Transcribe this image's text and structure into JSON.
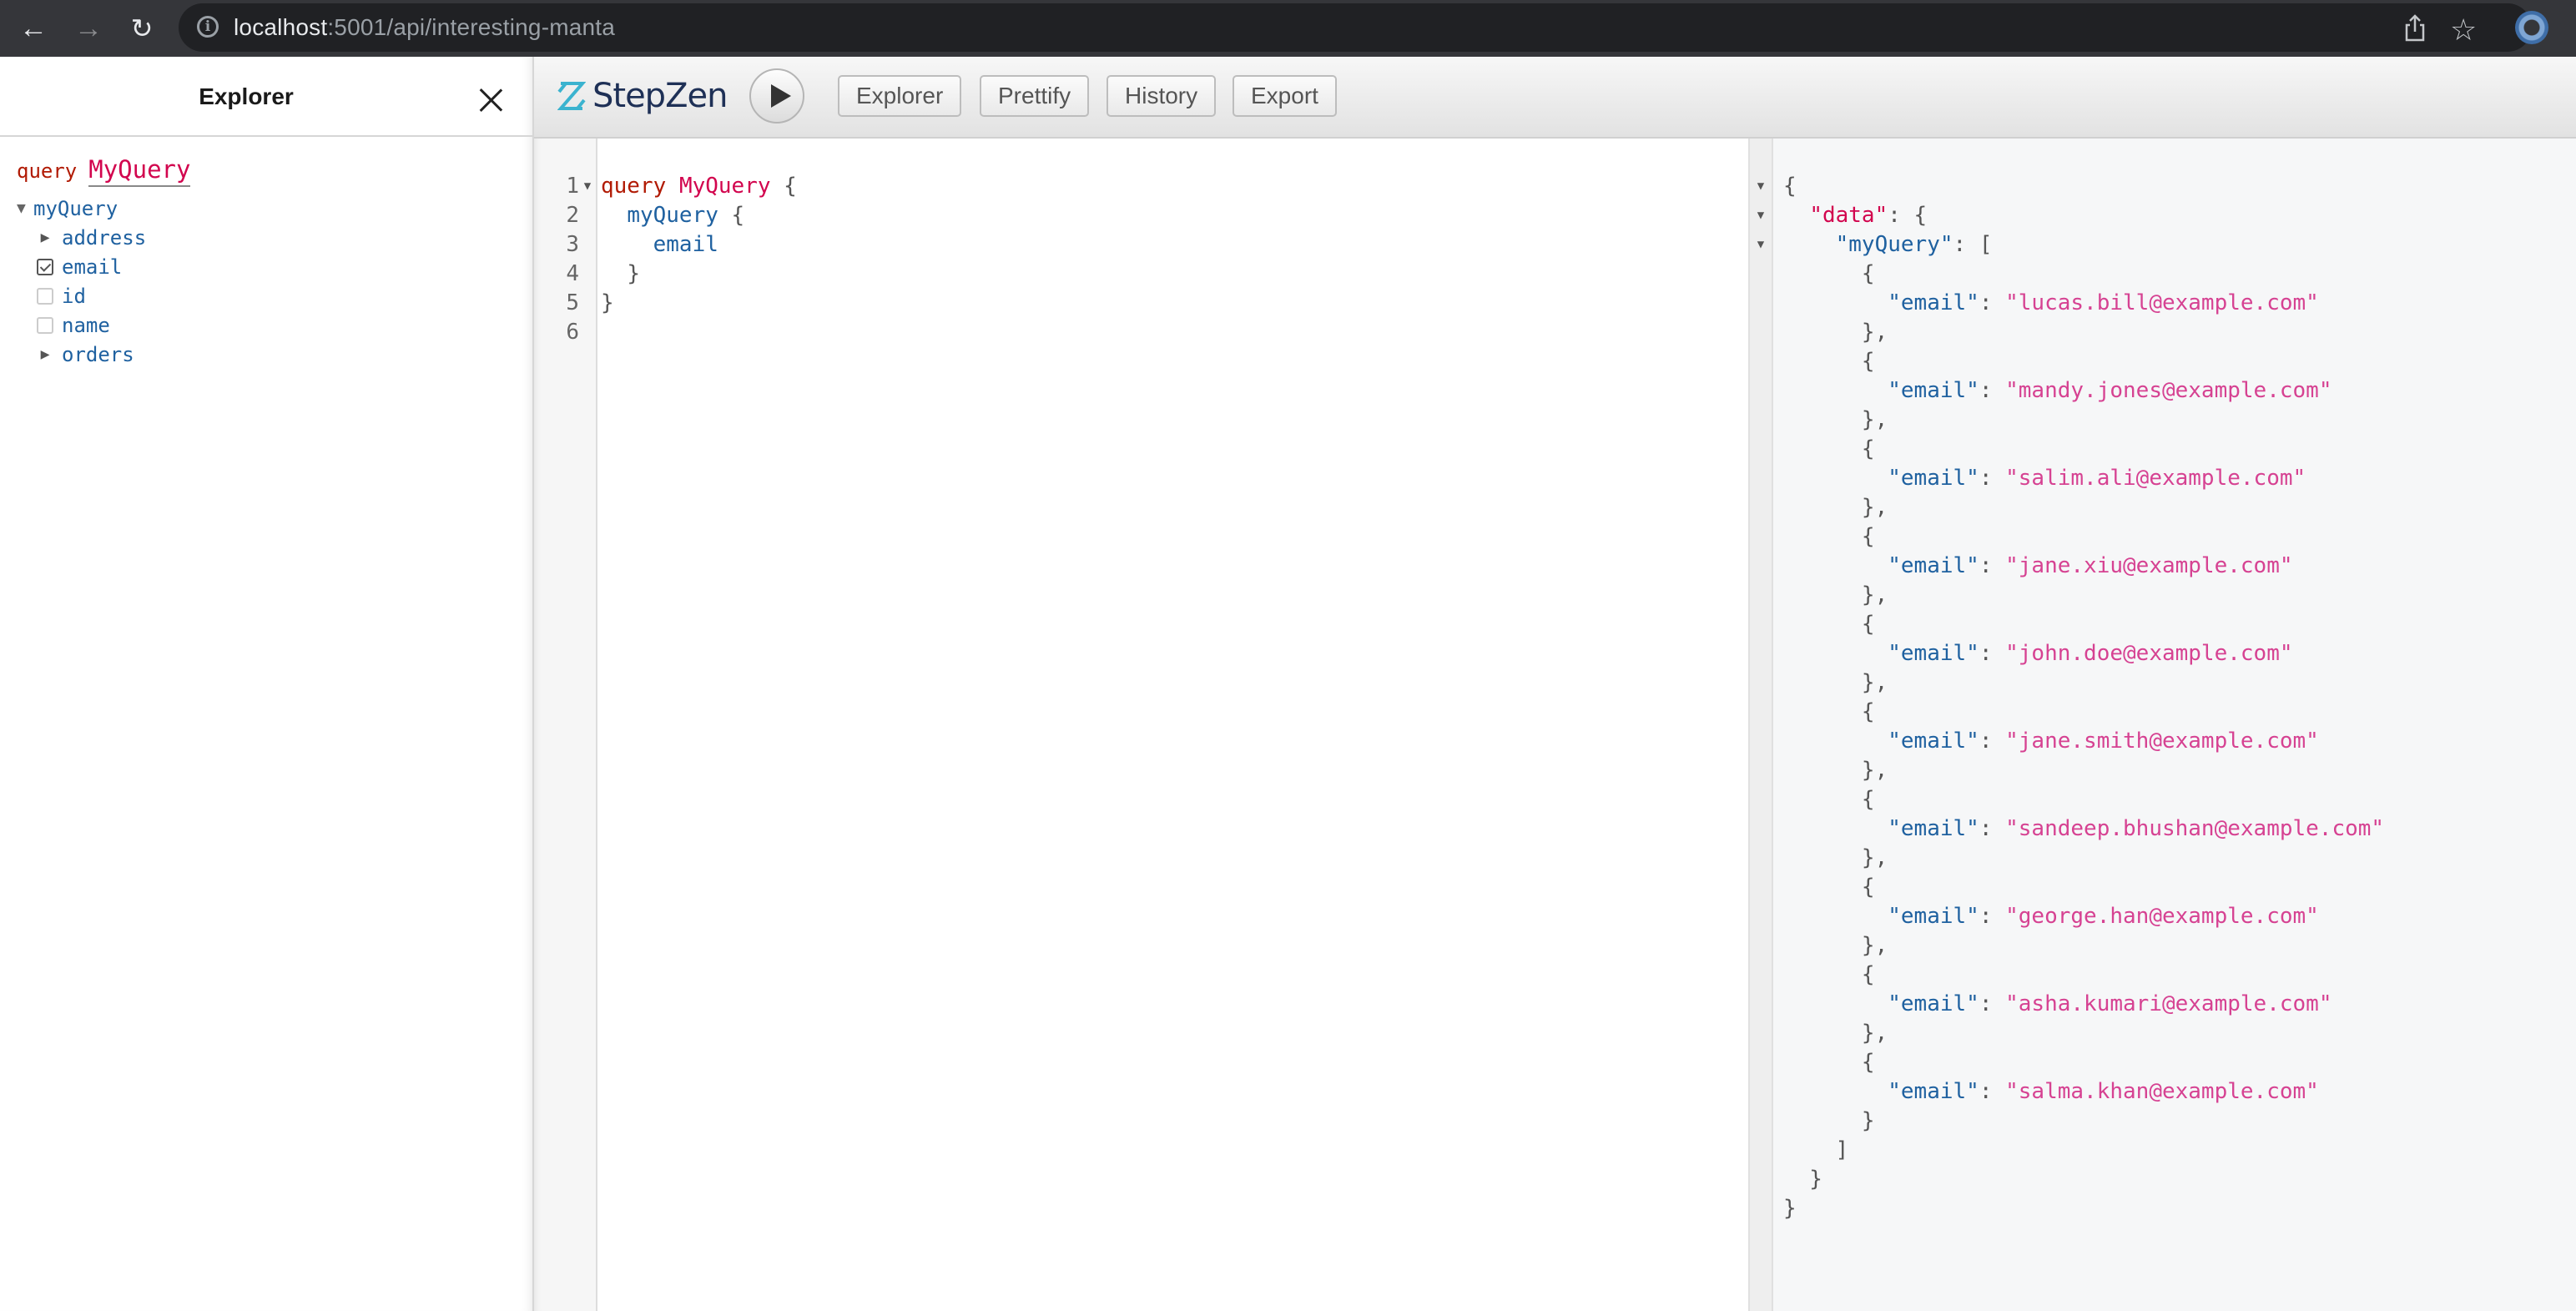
{
  "browser": {
    "url_host": "localhost",
    "url_path": ":5001/api/interesting-manta",
    "icons": [
      "back-arrow-icon",
      "forward-arrow-icon",
      "reload-icon",
      "info-icon",
      "share-icon",
      "star-icon",
      "profile-icon"
    ]
  },
  "explorer": {
    "title": "Explorer",
    "operation_keyword": "query",
    "operation_name": "MyQuery",
    "root_field": "myQuery",
    "fields": [
      {
        "name": "address",
        "type": "object",
        "expanded": false
      },
      {
        "name": "email",
        "type": "scalar",
        "checked": true
      },
      {
        "name": "id",
        "type": "scalar",
        "checked": false
      },
      {
        "name": "name",
        "type": "scalar",
        "checked": false
      },
      {
        "name": "orders",
        "type": "object",
        "expanded": false
      }
    ]
  },
  "toolbar": {
    "brand": "StepZen",
    "buttons": {
      "explorer": "Explorer",
      "prettify": "Prettify",
      "history": "History",
      "export": "Export"
    }
  },
  "editor": {
    "line_numbers": [
      "1",
      "2",
      "3",
      "4",
      "5",
      "6"
    ],
    "tokens": {
      "query_kw": "query",
      "op_name": "MyQuery",
      "open_brace": "{",
      "root_field": "myQuery",
      "field": "email",
      "close_brace": "}"
    }
  },
  "result": {
    "data_key": "\"data\"",
    "root_key": "\"myQuery\"",
    "item_key": "\"email\"",
    "emails": [
      "lucas.bill@example.com",
      "mandy.jones@example.com",
      "salim.ali@example.com",
      "jane.xiu@example.com",
      "john.doe@example.com",
      "jane.smith@example.com",
      "sandeep.bhushan@example.com",
      "george.han@example.com",
      "asha.kumari@example.com",
      "salma.khan@example.com"
    ]
  }
}
